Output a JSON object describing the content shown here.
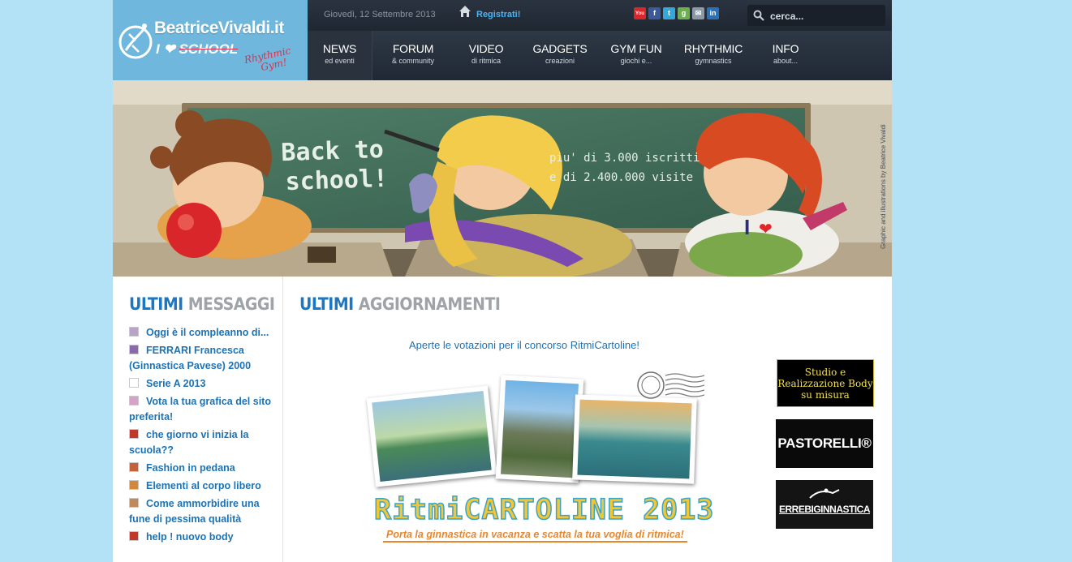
{
  "header": {
    "logo_title": "BeatriceVivaldi.it",
    "logo_tagline_pre": "I",
    "logo_tagline_word": "SCHOOL",
    "logo_script_1": "Rhythmic",
    "logo_script_2": "Gym!",
    "date": "Giovedì, 12 Settembre 2013",
    "register_label": "Registrati!",
    "social": [
      {
        "name": "youtube",
        "glyph": "You",
        "color": "#d8262a"
      },
      {
        "name": "facebook",
        "glyph": "f",
        "color": "#3b5a9a"
      },
      {
        "name": "twitter",
        "glyph": "t",
        "color": "#35a7d8"
      },
      {
        "name": "google",
        "glyph": "g",
        "color": "#6bb04a"
      },
      {
        "name": "email",
        "glyph": "✉",
        "color": "#8c9aa6"
      },
      {
        "name": "linkedin",
        "glyph": "in",
        "color": "#2a72b5"
      }
    ],
    "search_placeholder": "cerca..."
  },
  "nav": [
    {
      "label": "NEWS",
      "sub": "ed eventi",
      "active": true
    },
    {
      "label": "FORUM",
      "sub": "& community"
    },
    {
      "label": "VIDEO",
      "sub": "di ritmica"
    },
    {
      "label": "GADGETS",
      "sub": "creazioni"
    },
    {
      "label": "GYM FUN",
      "sub": "giochi e..."
    },
    {
      "label": "RHYTHMIC",
      "sub": "gymnastics"
    },
    {
      "label": "INFO",
      "sub": "about..."
    }
  ],
  "banner": {
    "headline_1": "Back to",
    "headline_2": "school!",
    "stats_1": "piu' di 3.000 iscritti",
    "stats_2": "e di 2.400.000 visite",
    "shirt_text": "I",
    "credit": "Graphic and illustrations by Beatrice Vivaldi"
  },
  "left": {
    "heading_a": "ULTIMI",
    "heading_b": "MESSAGGI",
    "posts": [
      {
        "title": "Oggi è il compleanno di..."
      },
      {
        "title": "FERRARI Francesca (Ginnastica Pavese) 2000"
      },
      {
        "title": "Serie A 2013"
      },
      {
        "title": "Vota la tua grafica del sito preferita!"
      },
      {
        "title": "che giorno vi inizia la scuola??"
      },
      {
        "title": "Fashion in pedana"
      },
      {
        "title": "Elementi al corpo libero"
      },
      {
        "title": "Come ammorbidire una fune di pessima qualità"
      },
      {
        "title": "help ! nuovo body"
      }
    ]
  },
  "right": {
    "heading_a": "ULTIMI",
    "heading_b": "AGGIORNAMENTI",
    "announcement": "Aperte le votazioni per il concorso RitmiCartoline!",
    "postcard_title": "RitmiCARTOLINE 2013",
    "postcard_subtitle": "Porta la ginnastica in vacanza e scatta la tua voglia di ritmica!",
    "ads": [
      {
        "label": "Studio e Realizzazione Body su misura"
      },
      {
        "label": "PASTORELLI®"
      },
      {
        "label": "ERREBIGINNASTICA"
      }
    ]
  }
}
